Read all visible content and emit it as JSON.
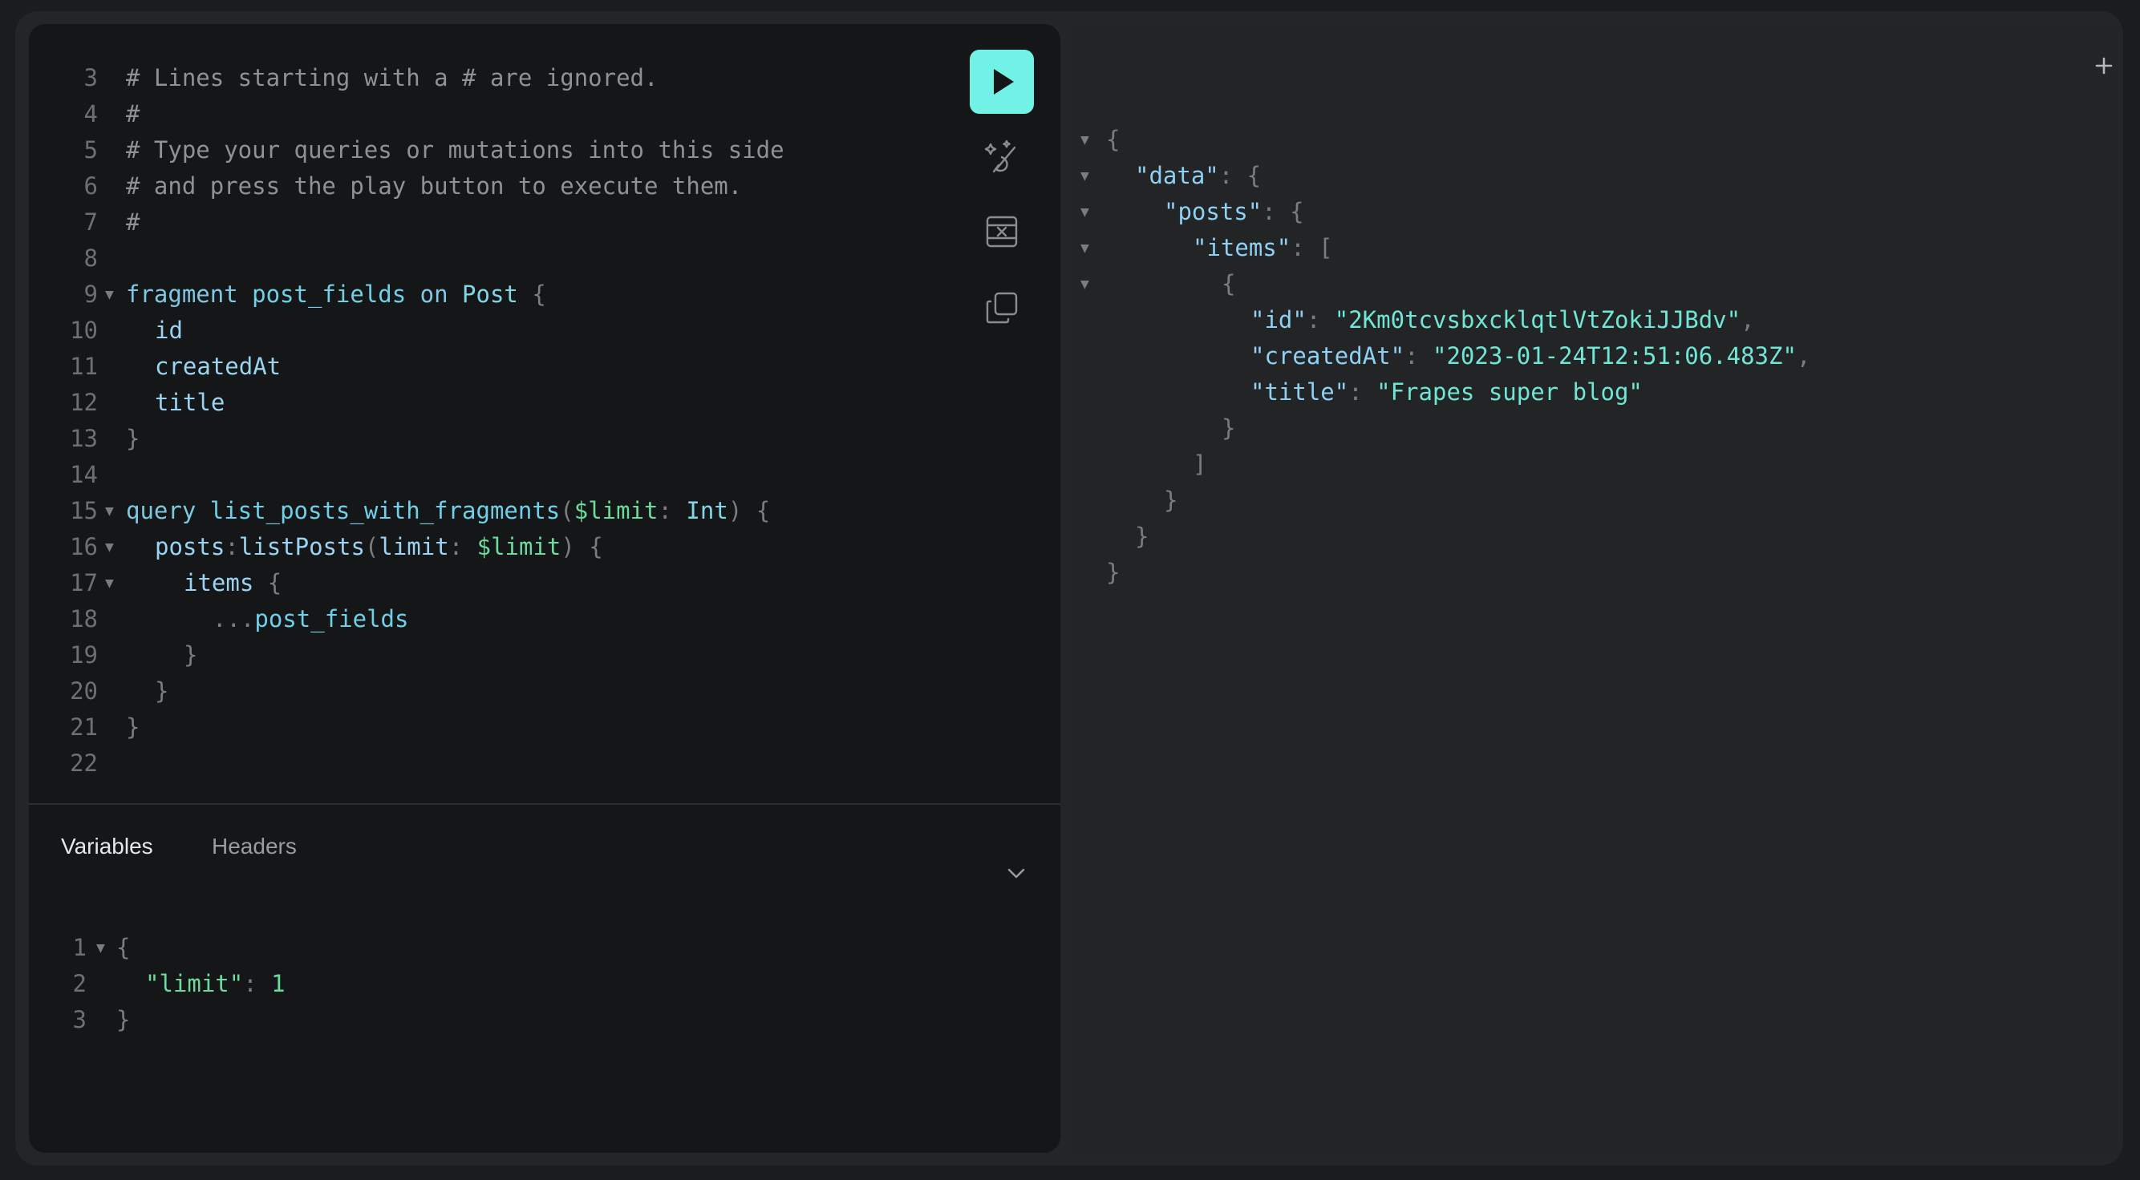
{
  "query_editor": {
    "lines": [
      {
        "n": "3",
        "fold": false,
        "indent": 0,
        "tokens": [
          {
            "t": "# Lines starting with a # are ignored.",
            "c": "c-comment"
          }
        ]
      },
      {
        "n": "4",
        "fold": false,
        "indent": 0,
        "tokens": [
          {
            "t": "#",
            "c": "c-comment"
          }
        ]
      },
      {
        "n": "5",
        "fold": false,
        "indent": 0,
        "tokens": [
          {
            "t": "# Type your queries or mutations into this side",
            "c": "c-comment"
          }
        ]
      },
      {
        "n": "6",
        "fold": false,
        "indent": 0,
        "tokens": [
          {
            "t": "# and press the play button to execute them.",
            "c": "c-comment"
          }
        ]
      },
      {
        "n": "7",
        "fold": false,
        "indent": 0,
        "tokens": [
          {
            "t": "#",
            "c": "c-comment"
          }
        ]
      },
      {
        "n": "8",
        "fold": false,
        "indent": 0,
        "tokens": []
      },
      {
        "n": "9",
        "fold": true,
        "indent": 0,
        "tokens": [
          {
            "t": "fragment ",
            "c": "c-kw"
          },
          {
            "t": "post_fields ",
            "c": "c-def"
          },
          {
            "t": "on ",
            "c": "c-kw"
          },
          {
            "t": "Post ",
            "c": "c-type"
          },
          {
            "t": "{",
            "c": "c-punc"
          }
        ]
      },
      {
        "n": "10",
        "fold": false,
        "indent": 1,
        "tokens": [
          {
            "t": "id",
            "c": "c-field"
          }
        ]
      },
      {
        "n": "11",
        "fold": false,
        "indent": 1,
        "tokens": [
          {
            "t": "createdAt",
            "c": "c-field"
          }
        ]
      },
      {
        "n": "12",
        "fold": false,
        "indent": 1,
        "tokens": [
          {
            "t": "title",
            "c": "c-field"
          }
        ]
      },
      {
        "n": "13",
        "fold": false,
        "indent": 0,
        "tokens": [
          {
            "t": "}",
            "c": "c-punc"
          }
        ]
      },
      {
        "n": "14",
        "fold": false,
        "indent": 0,
        "tokens": []
      },
      {
        "n": "15",
        "fold": true,
        "indent": 0,
        "tokens": [
          {
            "t": "query ",
            "c": "c-kw"
          },
          {
            "t": "list_posts_with_fragments",
            "c": "c-def"
          },
          {
            "t": "(",
            "c": "c-punc"
          },
          {
            "t": "$limit",
            "c": "c-var"
          },
          {
            "t": ": ",
            "c": "c-punc"
          },
          {
            "t": "Int",
            "c": "c-type"
          },
          {
            "t": ") {",
            "c": "c-punc"
          }
        ]
      },
      {
        "n": "16",
        "fold": true,
        "indent": 1,
        "tokens": [
          {
            "t": "posts",
            "c": "c-field"
          },
          {
            "t": ":",
            "c": "c-punc"
          },
          {
            "t": "listPosts",
            "c": "c-field"
          },
          {
            "t": "(",
            "c": "c-punc"
          },
          {
            "t": "limit",
            "c": "c-field"
          },
          {
            "t": ": ",
            "c": "c-punc"
          },
          {
            "t": "$limit",
            "c": "c-var"
          },
          {
            "t": ") {",
            "c": "c-punc"
          }
        ]
      },
      {
        "n": "17",
        "fold": true,
        "indent": 2,
        "tokens": [
          {
            "t": "items ",
            "c": "c-field"
          },
          {
            "t": "{",
            "c": "c-punc"
          }
        ]
      },
      {
        "n": "18",
        "fold": false,
        "indent": 3,
        "tokens": [
          {
            "t": "...",
            "c": "c-punc"
          },
          {
            "t": "post_fields",
            "c": "c-def"
          }
        ]
      },
      {
        "n": "19",
        "fold": false,
        "indent": 2,
        "tokens": [
          {
            "t": "}",
            "c": "c-punc"
          }
        ]
      },
      {
        "n": "20",
        "fold": false,
        "indent": 1,
        "tokens": [
          {
            "t": "}",
            "c": "c-punc"
          }
        ]
      },
      {
        "n": "21",
        "fold": false,
        "indent": 0,
        "tokens": [
          {
            "t": "}",
            "c": "c-punc"
          }
        ]
      },
      {
        "n": "22",
        "fold": false,
        "indent": 0,
        "tokens": []
      }
    ]
  },
  "toolbar": {
    "run_icon": "play-icon",
    "prettify_icon": "magic-wand-icon",
    "merge_icon": "merge-fragments-icon",
    "copy_icon": "copy-icon"
  },
  "tabs": {
    "variables": "Variables",
    "headers": "Headers",
    "toggle_icon": "chevron-down-icon"
  },
  "variables_editor": {
    "lines": [
      {
        "n": "1",
        "fold": true,
        "indent": 0,
        "tokens": [
          {
            "t": "{",
            "c": "c-punc"
          }
        ]
      },
      {
        "n": "2",
        "fold": false,
        "indent": 1,
        "tokens": [
          {
            "t": "\"limit\"",
            "c": "c-var"
          },
          {
            "t": ": ",
            "c": "c-punc"
          },
          {
            "t": "1",
            "c": "c-num"
          }
        ]
      },
      {
        "n": "3",
        "fold": false,
        "indent": 0,
        "tokens": [
          {
            "t": "}",
            "c": "c-punc"
          }
        ]
      }
    ]
  },
  "response": {
    "add_tab_icon": "plus-icon",
    "lines": [
      {
        "fold": true,
        "indent": 0,
        "tokens": [
          {
            "t": "{",
            "c": "c-punc"
          }
        ]
      },
      {
        "fold": true,
        "indent": 1,
        "tokens": [
          {
            "t": "\"data\"",
            "c": "c-key"
          },
          {
            "t": ": {",
            "c": "c-punc"
          }
        ]
      },
      {
        "fold": true,
        "indent": 2,
        "tokens": [
          {
            "t": "\"posts\"",
            "c": "c-key"
          },
          {
            "t": ": {",
            "c": "c-punc"
          }
        ]
      },
      {
        "fold": true,
        "indent": 3,
        "tokens": [
          {
            "t": "\"items\"",
            "c": "c-key"
          },
          {
            "t": ": [",
            "c": "c-punc"
          }
        ]
      },
      {
        "fold": true,
        "indent": 4,
        "tokens": [
          {
            "t": "{",
            "c": "c-punc"
          }
        ]
      },
      {
        "fold": false,
        "indent": 5,
        "tokens": [
          {
            "t": "\"id\"",
            "c": "c-key"
          },
          {
            "t": ": ",
            "c": "c-punc"
          },
          {
            "t": "\"2Km0tcvsbxcklqtlVtZokiJJBdv\"",
            "c": "c-str"
          },
          {
            "t": ",",
            "c": "c-punc"
          }
        ]
      },
      {
        "fold": false,
        "indent": 5,
        "tokens": [
          {
            "t": "\"createdAt\"",
            "c": "c-key"
          },
          {
            "t": ": ",
            "c": "c-punc"
          },
          {
            "t": "\"2023-01-24T12:51:06.483Z\"",
            "c": "c-str"
          },
          {
            "t": ",",
            "c": "c-punc"
          }
        ]
      },
      {
        "fold": false,
        "indent": 5,
        "tokens": [
          {
            "t": "\"title\"",
            "c": "c-key"
          },
          {
            "t": ": ",
            "c": "c-punc"
          },
          {
            "t": "\"Frapes super blog\"",
            "c": "c-str"
          }
        ]
      },
      {
        "fold": false,
        "indent": 4,
        "tokens": [
          {
            "t": "}",
            "c": "c-punc"
          }
        ]
      },
      {
        "fold": false,
        "indent": 3,
        "tokens": [
          {
            "t": "]",
            "c": "c-punc"
          }
        ]
      },
      {
        "fold": false,
        "indent": 2,
        "tokens": [
          {
            "t": "}",
            "c": "c-punc"
          }
        ]
      },
      {
        "fold": false,
        "indent": 1,
        "tokens": [
          {
            "t": "}",
            "c": "c-punc"
          }
        ]
      },
      {
        "fold": false,
        "indent": 0,
        "tokens": [
          {
            "t": "}",
            "c": "c-punc"
          }
        ]
      }
    ]
  }
}
